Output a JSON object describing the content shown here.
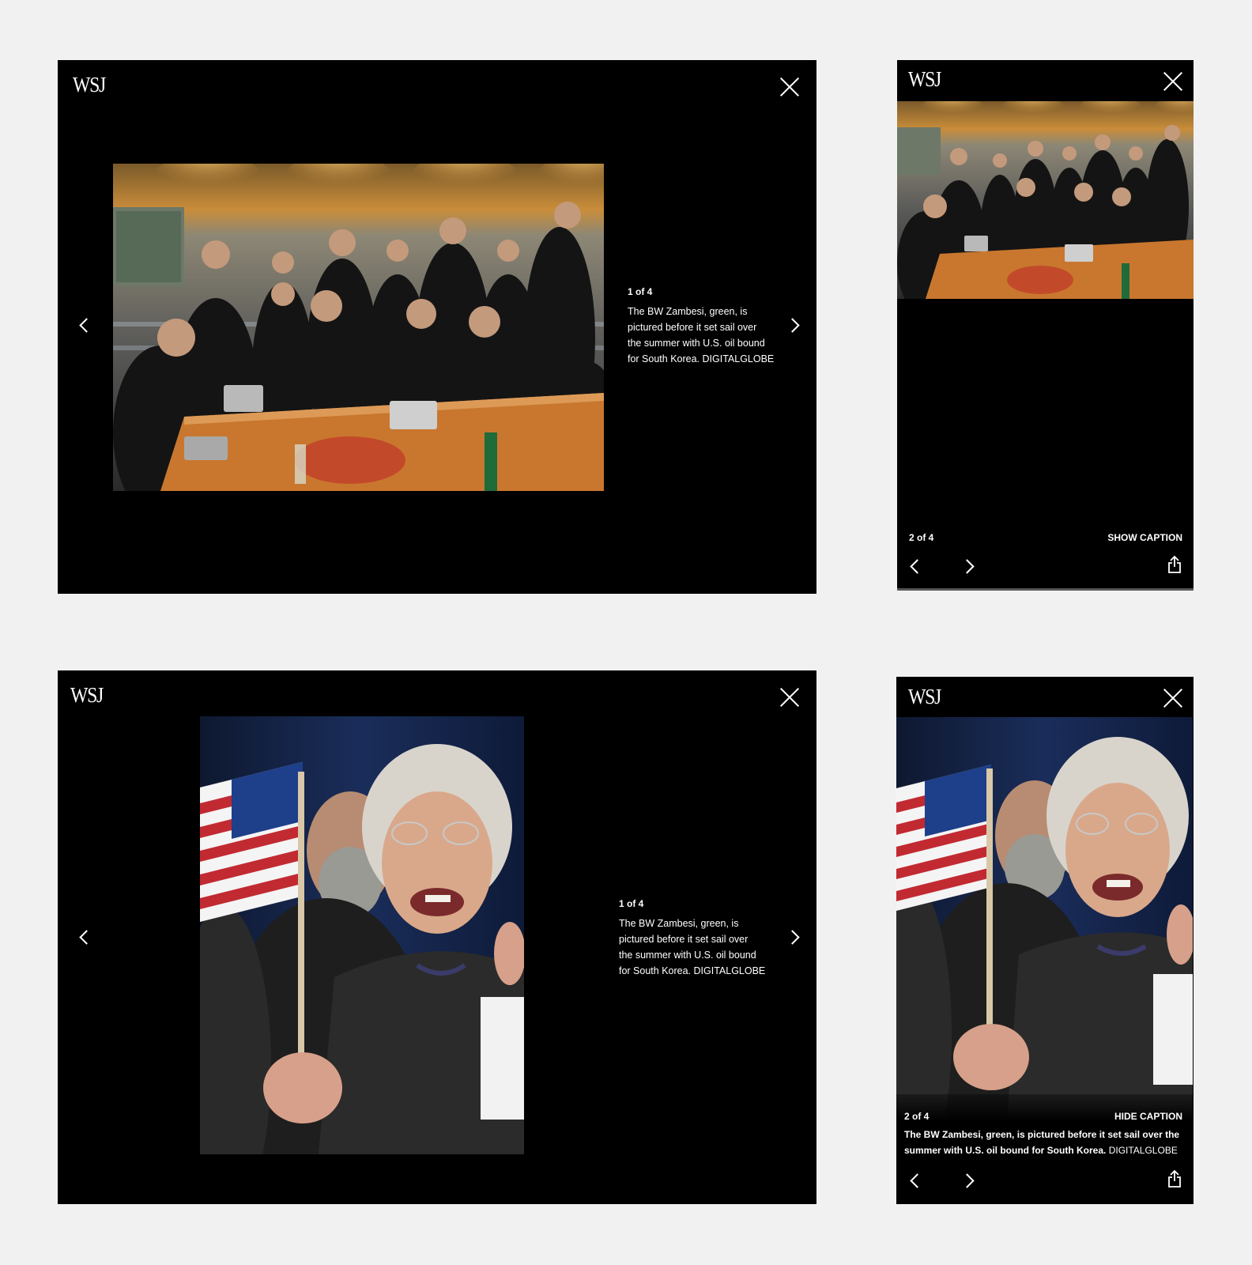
{
  "logo": "WSJ",
  "gallery": {
    "caption": "The BW Zambesi, green, is pictured before it set sail over the summer with U.S. oil bound  for South Korea.",
    "credit": "DIGITALGLOBE"
  },
  "desktop_top": {
    "counter": "1 of 4",
    "caption_lines": [
      "The BW Zambesi, green, is",
      "pictured before it set sail over",
      "the summer with U.S. oil bound",
      "for South Korea. DIGITALGLOBE"
    ]
  },
  "desktop_bottom": {
    "counter": "1 of 4",
    "caption_lines": [
      "The BW Zambesi, green, is",
      "pictured before it set sail over",
      "the summer with U.S. oil bound",
      "for South Korea. DIGITALGLOBE"
    ]
  },
  "mobile_top": {
    "counter": "2 of 4",
    "toggle_label": "SHOW CAPTION"
  },
  "mobile_bottom": {
    "counter": "2 of 4",
    "toggle_label": "HIDE CAPTION",
    "caption_line1": "The BW Zambesi, green, is pictured before it set sail over the",
    "caption_line2": "summer with U.S. oil bound  for South Korea.",
    "credit": "DIGITALGLOBE"
  },
  "icons": {
    "close": "close-icon",
    "prev": "chevron-left-icon",
    "next": "chevron-right-icon",
    "share": "share-icon"
  }
}
